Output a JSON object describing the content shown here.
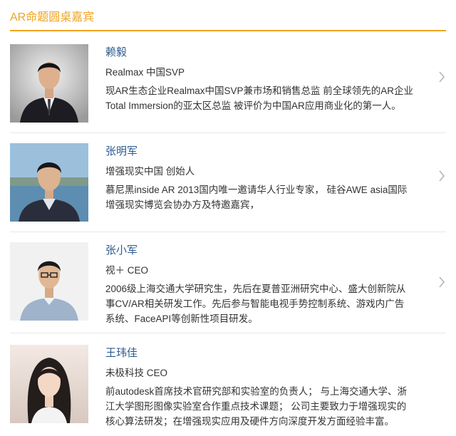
{
  "section": {
    "title": "AR命题圆桌嘉宾"
  },
  "guests": [
    {
      "name": "赖毅",
      "role": "Realmax 中国SVP",
      "desc_lines": [
        "现AR生态企业Realmax中国SVP兼市场和销售总监 前全球领先的AR企业",
        "Total Immersion的亚太区总监 被评价为中国AR应用商业化的第一人。"
      ]
    },
    {
      "name": "张明军",
      "role": "增强现实中国 创始人",
      "desc_lines": [
        "慕尼黑inside AR 2013国内唯一邀请华人行业专家， 硅谷AWE asia国际",
        "增强现实博览会协办方及特邀嘉宾，"
      ]
    },
    {
      "name": "张小军",
      "role": "视＋ CEO",
      "desc_lines": [
        "2006级上海交通大学研究生，先后在夏普亚洲研究中心、盛大创新院从",
        "事CV/AR相关研发工作。先后参与智能电视手势控制系统、游戏内广告",
        "系统、FaceAPI等创新性项目研发。"
      ]
    },
    {
      "name": "王玮佳",
      "role": "未极科技 CEO",
      "desc_lines": [
        "前autodesk首席技术官研究部和实验室的负责人； 与上海交通大学、浙",
        "江大学图形图像实验室合作重点技术课题； 公司主要致力于增强现实的",
        "核心算法研发；在增强现实应用及硬件方向深度开发方面经验丰富。"
      ]
    }
  ],
  "colors": {
    "accent": "#f0a31e",
    "name": "#2d5a8e",
    "text": "#333333",
    "divider": "#e8e8e8",
    "chevron": "#b5b5b5"
  },
  "icons": {
    "row_arrow": "chevron-right-icon"
  }
}
